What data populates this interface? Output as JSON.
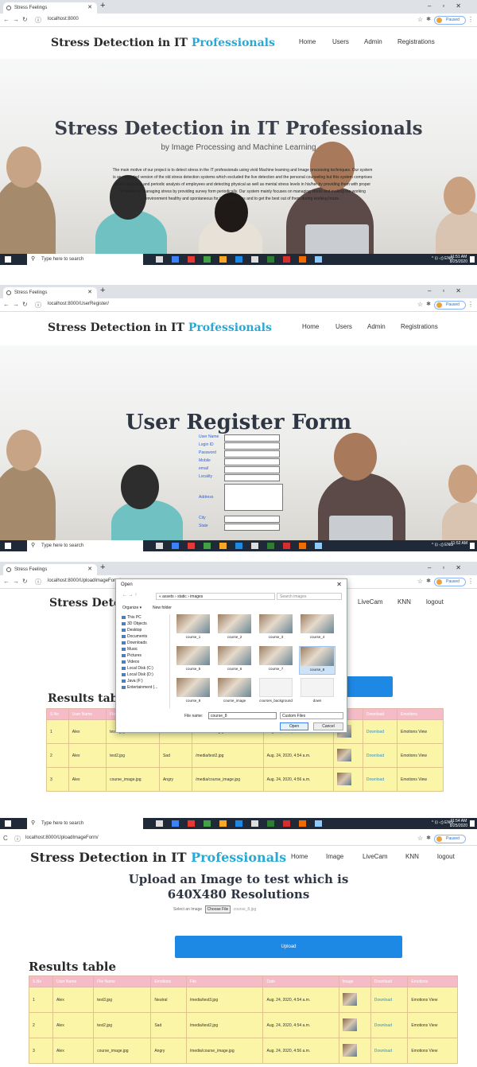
{
  "browser": {
    "tab_title": "Stress Feelings",
    "url_home": "localhost:8000",
    "url_register": "localhost:8000/UserRegister/",
    "url_upload": "localhost:8000/UploadImageForm/",
    "profile_label": "Paused"
  },
  "site": {
    "brand_main": "Stress Detection in IT ",
    "brand_highlight": "Professionals",
    "menu_public": [
      "Home",
      "Users",
      "Admin",
      "Registrations"
    ],
    "menu_user": [
      "Home",
      "Image",
      "LiveCam",
      "KNN",
      "logout"
    ]
  },
  "home": {
    "hero_title": "Stress Detection in IT Professionals",
    "hero_subtitle": "by Image Processing and Machine Learning",
    "hero_description": "The main motive of our project is to detect stress in the IT professionals using vivid Machine learning and Image processing techniques. Our system is an upgraded version of the old stress detection systems which excluded the live detection and the personal counseling but this system comprises of live detection and periodic analysis of employees and detecting physical as well as mental stress levels in his/her by providing them with proper remedies for managing stress by providing survey form periodically. Our system mainly focuses on managing stress and making the working environment healthy and spontaneous for the employees and to get the best out of them during working hours."
  },
  "register": {
    "title": "User Register Form",
    "fields": [
      "User Name",
      "Login ID",
      "Password",
      "Mobile",
      "email",
      "Locality",
      "Address",
      "City",
      "State"
    ]
  },
  "taskbar": {
    "search_placeholder": "Type here to search",
    "time_1": "11:51 AM",
    "date_1": "8/25/2020",
    "time_2": "11:52 AM",
    "time_3": "11:54 AM",
    "date_3": "8/25/2020"
  },
  "file_dialog": {
    "title": "Open",
    "path": "« assets › static › images",
    "search_placeholder": "Search images",
    "organize": "Organize ▾",
    "new_folder": "New folder",
    "sidebar": [
      "This PC",
      "3D Objects",
      "Desktop",
      "Documents",
      "Downloads",
      "Music",
      "Pictures",
      "Videos",
      "Local Disk (C:)",
      "Local Disk (D:)",
      "Java (F:)",
      "Entertainment (..."
    ],
    "files": [
      "course_1",
      "course_2",
      "course_3",
      "course_4",
      "course_5",
      "course_6",
      "course_7",
      "course_8",
      "course_9",
      "course_image",
      "courses_background",
      "down"
    ],
    "filename_label": "File name:",
    "filename_value": "course_8",
    "filter": "Custom Files",
    "open_label": "Open",
    "cancel_label": "Cancel"
  },
  "upload": {
    "heading_line1": "Upload an Image to test which is",
    "heading_line2": "640X480 Resolutions",
    "select_label": "Select an Image",
    "choose_file": "Choose File",
    "chosen_file": "course_8.jpg",
    "upload_button": "Upload"
  },
  "results": {
    "title": "Results table",
    "columns": [
      "S.No",
      "User Name",
      "File Name",
      "Emotions",
      "File",
      "Date",
      "Image",
      "Download",
      "Emotions"
    ],
    "rows": [
      {
        "sno": "1",
        "user": "Alex",
        "file_name": "test3.jpg",
        "emotion": "Neutral",
        "file": "/media/test3.jpg",
        "date": "Aug. 24, 2020, 4:54 a.m.",
        "download": "Download",
        "view": "Emotions View"
      },
      {
        "sno": "2",
        "user": "Alex",
        "file_name": "test2.jpg",
        "emotion": "Sad",
        "file": "/media/test2.jpg",
        "date": "Aug. 24, 2020, 4:54 a.m.",
        "download": "Download",
        "view": "Emotions View"
      },
      {
        "sno": "3",
        "user": "Alex",
        "file_name": "course_image.jpg",
        "emotion": "Angry",
        "file": "/media/course_image.jpg",
        "date": "Aug. 24, 2020, 4:56 a.m.",
        "download": "Download",
        "view": "Emotions View"
      }
    ]
  }
}
